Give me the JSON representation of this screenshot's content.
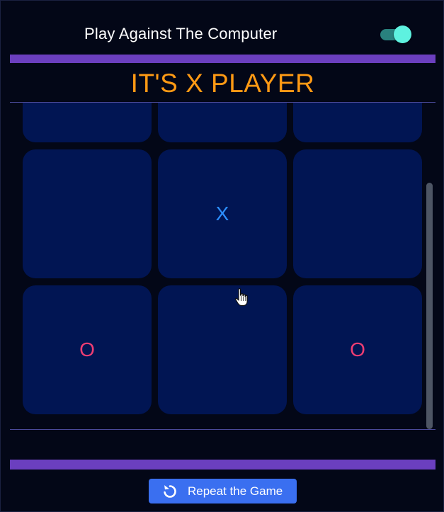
{
  "header": {
    "title": "Play Against The Computer",
    "toggle_on": true
  },
  "status": {
    "text": "IT'S X PLAYER"
  },
  "board": {
    "cells": [
      "",
      "",
      "",
      "",
      "X",
      "",
      "O",
      "",
      "O"
    ]
  },
  "actions": {
    "repeat_label": "Repeat the Game",
    "repeat_icon": "refresh-icon"
  },
  "colors": {
    "background": "#030717",
    "accent_bar": "#6b3fbf",
    "status_text": "#ff9a14",
    "cell": "#011553",
    "mark_x": "#2c8fff",
    "mark_o": "#ee3d73",
    "toggle_knob": "#5ef2e0",
    "button": "#3a6ff0"
  }
}
